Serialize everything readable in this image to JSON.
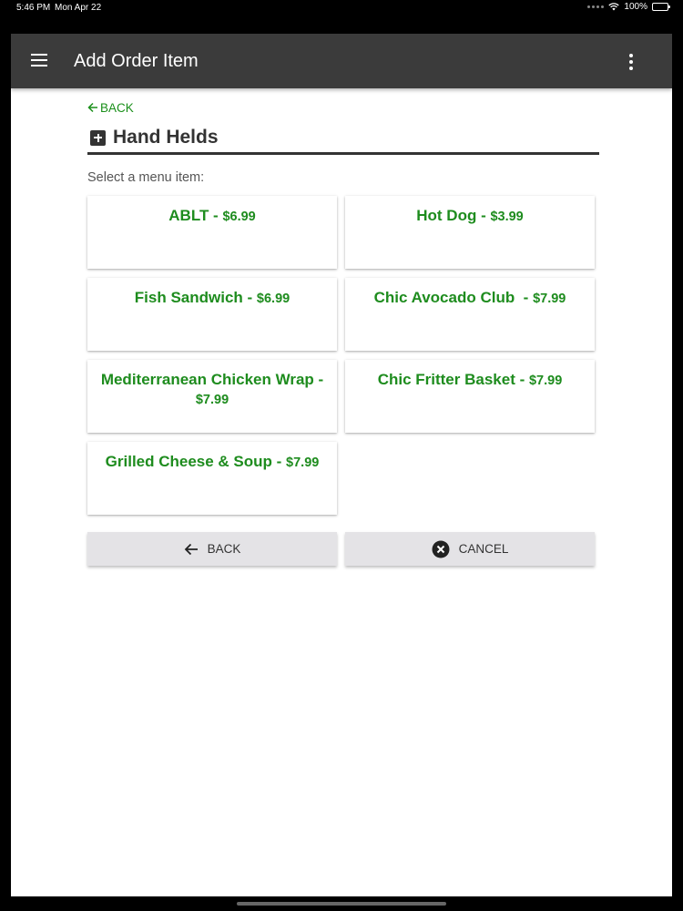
{
  "status_bar": {
    "time": "5:46 PM",
    "date": "Mon Apr 22",
    "battery": "100%",
    "battery_level": 1.0,
    "icons": [
      "signal-dots-icon",
      "wifi-icon",
      "battery-icon"
    ]
  },
  "app_bar": {
    "title": "Add Order Item",
    "left_icon": "menu-icon",
    "right_icon": "more-vert-icon"
  },
  "back_link": {
    "label": "BACK",
    "icon": "arrow-left-icon"
  },
  "section": {
    "title": "Hand Helds",
    "icon": "plus-box-icon"
  },
  "prompt": "Select a menu item:",
  "menu_items": [
    {
      "name": "ABLT",
      "price": "$6.99"
    },
    {
      "name": "Hot Dog",
      "price": "$3.99"
    },
    {
      "name": "Fish Sandwich",
      "price": "$6.99"
    },
    {
      "name": "Chic Avocado Club ",
      "price": "$7.99"
    },
    {
      "name": "Mediterranean Chicken Wrap",
      "price": "$7.99"
    },
    {
      "name": "Chic Fritter Basket",
      "price": "$7.99"
    },
    {
      "name": "Grilled Cheese & Soup",
      "price": "$7.99"
    }
  ],
  "buttons": {
    "back": {
      "label": "BACK",
      "icon": "arrow-left-icon"
    },
    "cancel": {
      "label": "CANCEL",
      "icon": "close-circle-icon"
    }
  },
  "colors": {
    "accent_green": "#1e8c1e",
    "app_bar": "#3b3b3b",
    "button_bg": "#e4e3e6"
  }
}
